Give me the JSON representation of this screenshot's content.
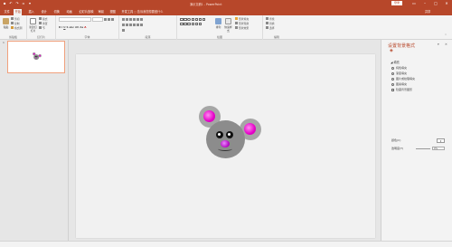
{
  "window": {
    "title": "演示文稿1 - PowerPoint",
    "login_label": "登录",
    "share_label": "共享"
  },
  "quick_access": [
    "save-icon",
    "undo-icon",
    "redo-icon",
    "present-icon",
    "customize-icon"
  ],
  "tabs": [
    {
      "label": "文件"
    },
    {
      "label": "开始"
    },
    {
      "label": "插入"
    },
    {
      "label": "设计"
    },
    {
      "label": "切换"
    },
    {
      "label": "动画"
    },
    {
      "label": "幻灯片放映"
    },
    {
      "label": "审阅"
    },
    {
      "label": "视图"
    },
    {
      "label": "开发工具"
    }
  ],
  "tell_me": "告诉我您想要做什么",
  "ribbon": {
    "clipboard": {
      "label": "剪贴板",
      "paste": "粘贴",
      "cut": "剪切",
      "copy": "复制",
      "painter": "格式刷"
    },
    "slides": {
      "label": "幻灯片",
      "new_slide": "新建幻灯片",
      "layout": "版式",
      "reset": "重置",
      "section": "节"
    },
    "font": {
      "label": "字体"
    },
    "paragraph": {
      "label": "段落"
    },
    "drawing": {
      "label": "绘图",
      "arrange": "排列",
      "quick_styles": "快速样式",
      "shape_fill": "形状填充",
      "shape_outline": "形状轮廓",
      "shape_effects": "形状效果"
    },
    "editing": {
      "label": "编辑",
      "find": "查找",
      "replace": "替换",
      "select": "选择"
    }
  },
  "thumbnails": [
    {
      "number": "1"
    }
  ],
  "format_pane": {
    "title": "设置背景格式",
    "section": "填充",
    "fill_options": [
      {
        "label": "纯色填充",
        "selected": true
      },
      {
        "label": "渐变填充",
        "selected": false
      },
      {
        "label": "图片或纹理填充",
        "selected": false
      },
      {
        "label": "图案填充",
        "selected": false
      }
    ],
    "hide_background": "隐藏背景图形",
    "color_label": "颜色(C)",
    "transparency_label": "透明度(T)",
    "transparency_value": "0%"
  },
  "colors": {
    "accent": "#b7472a",
    "mouse_gray": "#8c8c8c",
    "ear_gray": "#a6a6a6",
    "ear_inner": "#e600c8"
  }
}
